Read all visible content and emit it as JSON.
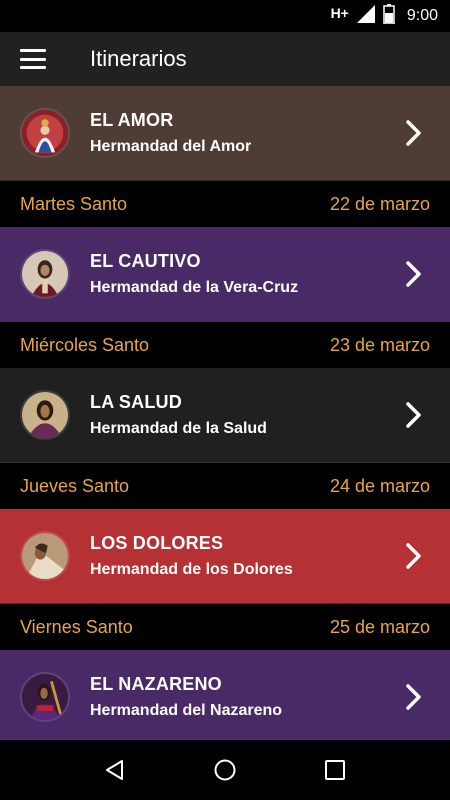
{
  "status_bar": {
    "network": "H+",
    "time": "9:00",
    "icons": [
      "signal-icon",
      "battery-icon"
    ]
  },
  "app_bar": {
    "title": "Itinerarios",
    "menu_icon": "hamburger-menu-icon"
  },
  "colors": {
    "app_bar": "#212121",
    "header_text": "#e6a54a",
    "amor": "#4f3d35",
    "cautivo": "#4a2a66",
    "salud": "#202020",
    "dolores": "#b53133",
    "nazareno": "#4a2a66"
  },
  "items": [
    {
      "title": "EL AMOR",
      "subtitle": "Hermandad del Amor",
      "image": "virgin-avatar-icon"
    },
    {
      "title": "EL CAUTIVO",
      "subtitle": "Hermandad de la Vera-Cruz",
      "image": "cautivo-avatar-icon"
    },
    {
      "title": "LA SALUD",
      "subtitle": "Hermandad de la Salud",
      "image": "salud-avatar-icon"
    },
    {
      "title": "LOS DOLORES",
      "subtitle": "Hermandad de los Dolores",
      "image": "dolores-avatar-icon"
    },
    {
      "title": "EL NAZARENO",
      "subtitle": "Hermandad del Nazareno",
      "image": "nazareno-avatar-icon"
    }
  ],
  "days": [
    {
      "name": "Martes Santo",
      "date": "22 de marzo"
    },
    {
      "name": "Miércoles Santo",
      "date": "23 de marzo"
    },
    {
      "name": "Jueves Santo",
      "date": "24 de marzo"
    },
    {
      "name": "Viernes Santo",
      "date": "25 de marzo"
    }
  ],
  "nav_bar": [
    "back-icon",
    "home-icon",
    "recents-icon"
  ]
}
